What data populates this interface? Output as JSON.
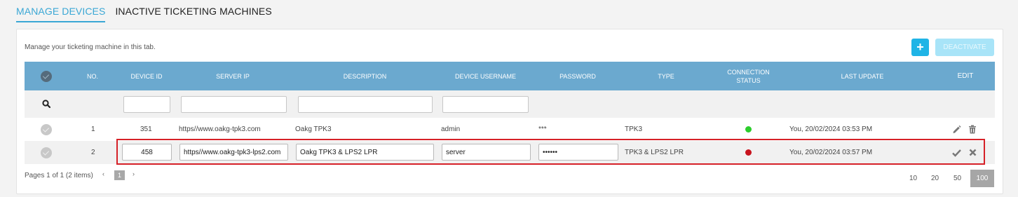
{
  "tabs": [
    {
      "label": "MANAGE DEVICES",
      "active": true
    },
    {
      "label": "INACTIVE TICKETING MACHINES",
      "active": false
    }
  ],
  "card": {
    "description": "Manage your ticketing machine in this tab.",
    "add_label": "+",
    "deactivate_label": "DEACTIVATE"
  },
  "columns": {
    "no": "NO.",
    "device_id": "DEVICE ID",
    "server_ip": "SERVER IP",
    "description": "DESCRIPTION",
    "device_username": "DEVICE USERNAME",
    "password": "PASSWORD",
    "type": "TYPE",
    "connection_status_1": "CONNECTION",
    "connection_status_2": "STATUS",
    "last_update": "LAST UPDATE",
    "edit": "EDIT"
  },
  "rows": [
    {
      "no": "1",
      "device_id": "351",
      "server_ip": "https//www.oakg-tpk3.com",
      "description": "Oakg TPK3",
      "device_username": "admin",
      "password": "***",
      "type": "TPK3",
      "status_color": "#2ccd2c",
      "last_update": "You, 20/02/2024 03:53 PM"
    },
    {
      "no": "2",
      "device_id": "458",
      "server_ip": "https//www.oakg-tpk3-lps2.com",
      "description": "Oakg TPK3 & LPS2 LPR",
      "device_username": "server",
      "password": "••••••",
      "type": "TPK3 & LPS2 LPR",
      "status_color": "#c8141e",
      "last_update": "You, 20/02/2024 03:57 PM"
    }
  ],
  "pagination": {
    "summary": "Pages 1 of 1 (2 items)",
    "prev": "‹",
    "current": "1",
    "next": "›",
    "page_sizes": [
      "10",
      "20",
      "50",
      "100"
    ],
    "selected_size": "100"
  },
  "colors": {
    "accent": "#3aa7d5",
    "header_bg": "#6ba9cf",
    "highlight": "#d62128"
  }
}
